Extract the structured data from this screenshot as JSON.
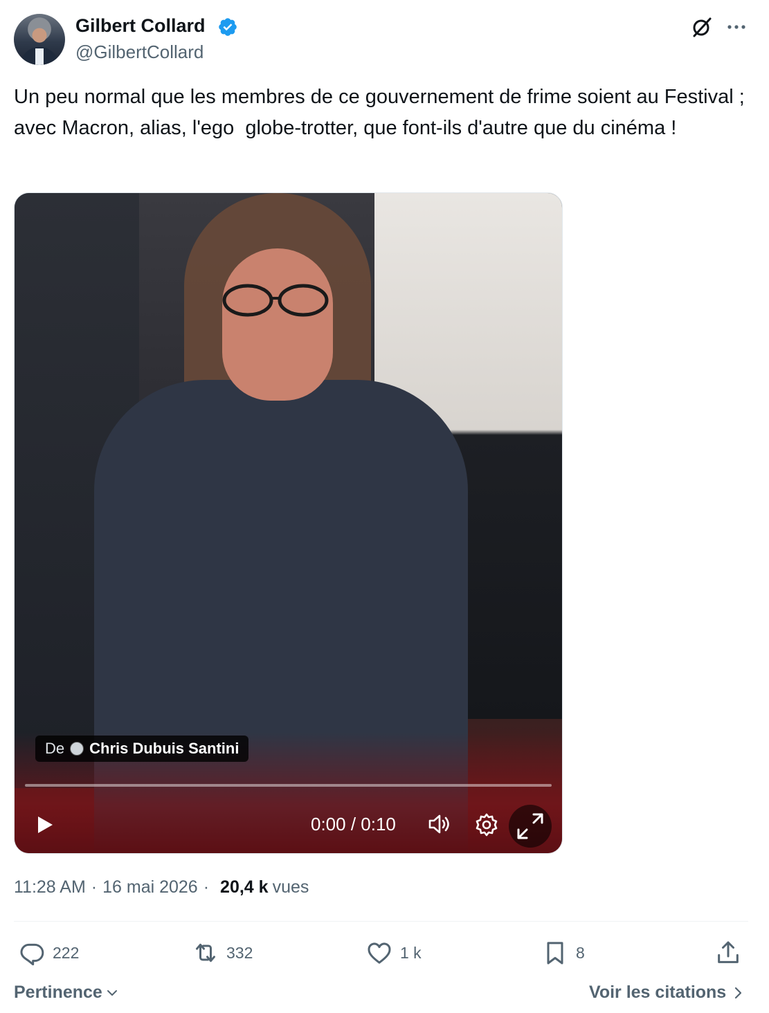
{
  "author": {
    "name": "Gilbert Collard",
    "handle": "@GilbertCollard"
  },
  "tweet": {
    "text": "Un peu normal que les membres de ce gouvernement de frime soient au Festival ; avec Macron, alias, l'ego  globe-trotter, que font-ils d'autre que du cinéma !"
  },
  "video": {
    "credit_prefix": "De",
    "credit_name": "Chris Dubuis Santini",
    "time": "0:00 / 0:10",
    "progress": 0
  },
  "meta": {
    "time": "11:28 AM",
    "date": "16 mai 2026",
    "views_count": "20,4 k",
    "views_label": "vues"
  },
  "actions": {
    "replies": "222",
    "reposts": "332",
    "likes": "1 k",
    "bookmarks": "8"
  },
  "footer": {
    "sort_label": "Pertinence",
    "quotes_label": "Voir les citations"
  },
  "colors": {
    "verified": "#1d9bf0",
    "text_primary": "#0f1419",
    "text_secondary": "#536471"
  },
  "icons": [
    "grok-icon",
    "more-icon",
    "verified-icon",
    "play-icon",
    "volume-icon",
    "settings-icon",
    "expand-icon",
    "reply-icon",
    "repost-icon",
    "like-icon",
    "bookmark-icon",
    "share-icon",
    "chevron-down-icon",
    "chevron-right-icon"
  ]
}
